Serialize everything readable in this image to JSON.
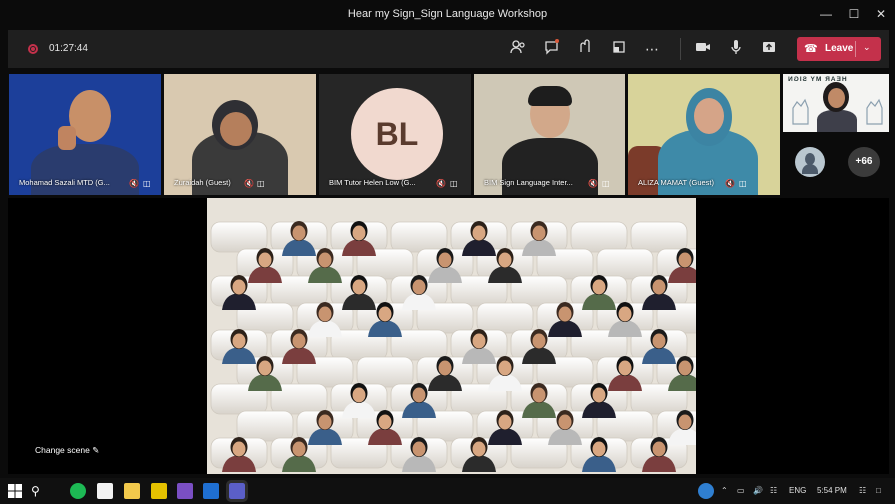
{
  "window": {
    "title": "Hear my Sign_Sign Language Workshop"
  },
  "toolbar": {
    "timer": "01:27:44",
    "leave_label": "Leave"
  },
  "participants": [
    {
      "name": "Mohamad Sazali MTD (G..."
    },
    {
      "name": "Zuraidah (Guest)"
    },
    {
      "name": "BIM Tutor Helen Low (G...",
      "initials": "BL"
    },
    {
      "name": "BIM Sign Language Inter..."
    },
    {
      "name": "ALIZA MAMAT (Guest)"
    }
  ],
  "side": {
    "card_caption": "HEAR MY SIGN",
    "overflow_count": "+66"
  },
  "stage": {
    "change_scene_label": "Change scene"
  },
  "taskbar": {
    "language": "ENG",
    "clock": "5:54 PM"
  },
  "colors": {
    "leave": "#c4314b",
    "titlebar": "#0b0b0b",
    "toolbar": "#1f1f1f"
  }
}
